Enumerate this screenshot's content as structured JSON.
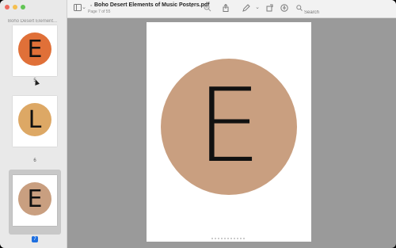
{
  "sidebar": {
    "title": "Boho Desert Element...",
    "thumbnails": [
      {
        "letter": "E",
        "color": "#e07038",
        "label": "5"
      },
      {
        "letter": "L",
        "color": "#dda865",
        "label": "6"
      },
      {
        "letter": "E",
        "color": "#c99f80",
        "label": "7"
      }
    ]
  },
  "toolbar": {
    "doc_title": "Boho Desert Elements of Music Posters.pdf",
    "page_info": "Page 7 of 55",
    "search_placeholder": "Search",
    "icons": [
      "sidebar-toggle-icon",
      "chevron-down-icon",
      "zoom-out-icon",
      "share-icon",
      "markup-pen-icon",
      "chevron-down-icon",
      "rotate-icon",
      "accessibility-icon",
      "search-icon"
    ]
  },
  "page": {
    "letter": "E",
    "circle_color": "#c99f80"
  }
}
